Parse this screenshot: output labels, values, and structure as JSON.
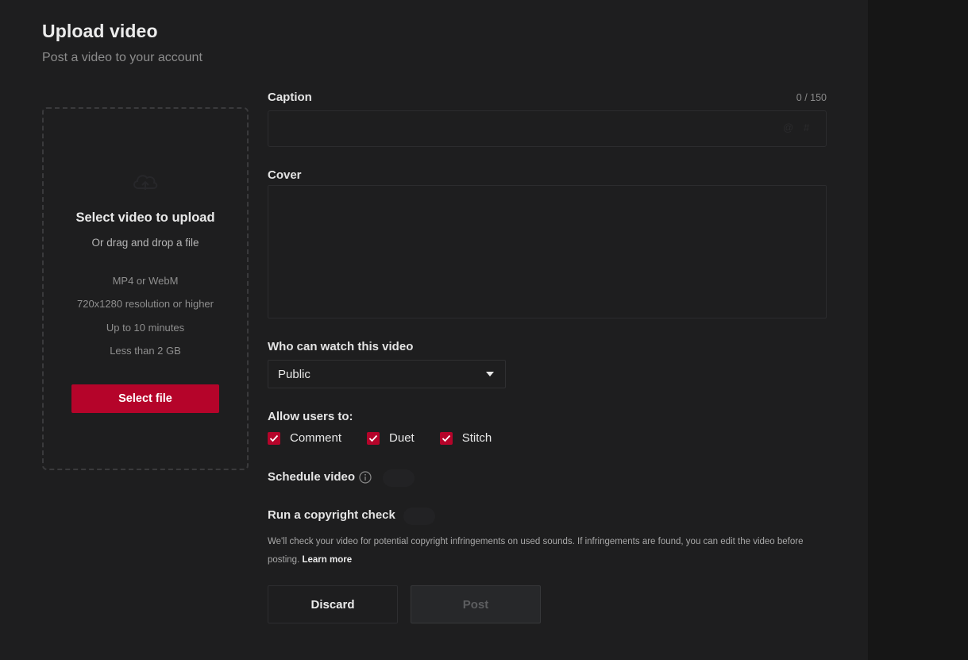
{
  "header": {
    "title": "Upload video",
    "subtitle": "Post a video to your account"
  },
  "upload": {
    "icon": "cloud-upload-icon",
    "title": "Select video to upload",
    "subtitle": "Or drag and drop a file",
    "requirements": [
      "MP4 or WebM",
      "720x1280 resolution or higher",
      "Up to 10 minutes",
      "Less than 2 GB"
    ],
    "button_label": "Select file"
  },
  "caption": {
    "label": "Caption",
    "counter": "0 / 150",
    "value": "",
    "icons": [
      "at-icon",
      "hashtag-icon"
    ]
  },
  "cover": {
    "label": "Cover"
  },
  "privacy": {
    "label": "Who can watch this video",
    "selected": "Public"
  },
  "permissions": {
    "label": "Allow users to:",
    "items": [
      {
        "label": "Comment",
        "checked": true
      },
      {
        "label": "Duet",
        "checked": true
      },
      {
        "label": "Stitch",
        "checked": true
      }
    ]
  },
  "schedule": {
    "label": "Schedule video",
    "enabled": false
  },
  "copyright": {
    "label": "Run a copyright check",
    "enabled": false,
    "note": "We'll check your video for potential copyright infringements on used sounds. If infringements are found, you can edit the video before posting.",
    "learn_more": "Learn more"
  },
  "actions": {
    "discard_label": "Discard",
    "post_label": "Post",
    "post_enabled": false
  },
  "colors": {
    "accent": "#b5042a",
    "background": "#1e1e1f",
    "page": "#161616"
  }
}
